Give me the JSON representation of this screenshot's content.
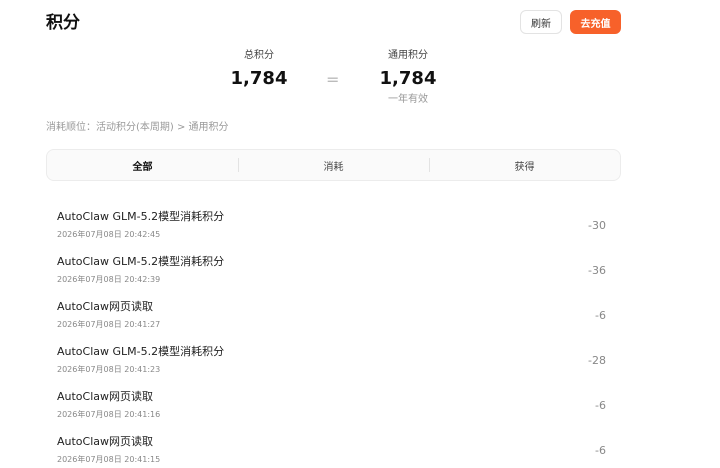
{
  "header": {
    "title": "积分",
    "refresh_label": "刷新",
    "recharge_label": "去充值"
  },
  "summary": {
    "total_label": "总积分",
    "total_value": "1,784",
    "equals": "=",
    "general_label": "通用积分",
    "general_value": "1,784",
    "general_sub": "一年有效"
  },
  "order_note": "消耗顺位：活动积分(本周期) > 通用积分",
  "tabs": [
    {
      "label": "全部",
      "active": true
    },
    {
      "label": "消耗",
      "active": false
    },
    {
      "label": "获得",
      "active": false
    }
  ],
  "records": [
    {
      "title": "AutoClaw GLM-5.2模型消耗积分",
      "time": "2026年07月08日 20:42:45",
      "amount": "-30"
    },
    {
      "title": "AutoClaw GLM-5.2模型消耗积分",
      "time": "2026年07月08日 20:42:39",
      "amount": "-36"
    },
    {
      "title": "AutoClaw网页读取",
      "time": "2026年07月08日 20:41:27",
      "amount": "-6"
    },
    {
      "title": "AutoClaw GLM-5.2模型消耗积分",
      "time": "2026年07月08日 20:41:23",
      "amount": "-28"
    },
    {
      "title": "AutoClaw网页读取",
      "time": "2026年07月08日 20:41:16",
      "amount": "-6"
    },
    {
      "title": "AutoClaw网页读取",
      "time": "2026年07月08日 20:41:15",
      "amount": "-6"
    }
  ],
  "colors": {
    "accent": "#f7612a"
  }
}
